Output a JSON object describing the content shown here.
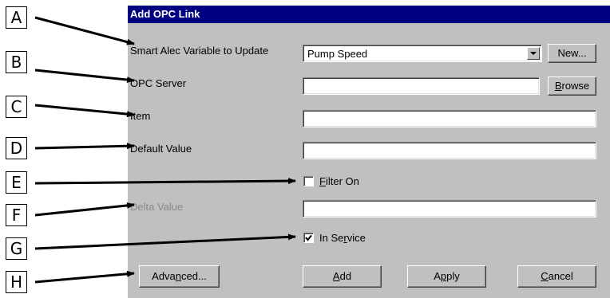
{
  "callouts": [
    "A",
    "B",
    "C",
    "D",
    "E",
    "F",
    "G",
    "H"
  ],
  "dialog": {
    "title": "Add OPC Link",
    "variable_label": "Smart Alec Variable to Update",
    "variable_value": "Pump Speed",
    "new_button": "New...",
    "server_label": "OPC Server",
    "server_value": "",
    "browse_button": {
      "pre": "",
      "key": "B",
      "post": "rowse"
    },
    "item_label": "Item",
    "item_value": "",
    "default_label": "Default Value",
    "default_value": "",
    "filter_label": {
      "pre": "",
      "key": "F",
      "post": "ilter On"
    },
    "filter_checked": false,
    "delta_label": "Delta Value",
    "delta_value": "",
    "service_label": {
      "pre": "In Se",
      "key": "r",
      "post": "vice"
    },
    "service_checked": true,
    "advanced_button": {
      "pre": "Adva",
      "key": "n",
      "post": "ced..."
    },
    "add_button": {
      "pre": "",
      "key": "A",
      "post": "dd"
    },
    "apply_button": {
      "pre": "A",
      "key": "p",
      "post": "ply"
    },
    "cancel_button": {
      "pre": "",
      "key": "C",
      "post": "ancel"
    }
  },
  "icons": {
    "dropdown": "chevron-down-icon",
    "check": "checkmark-icon"
  }
}
